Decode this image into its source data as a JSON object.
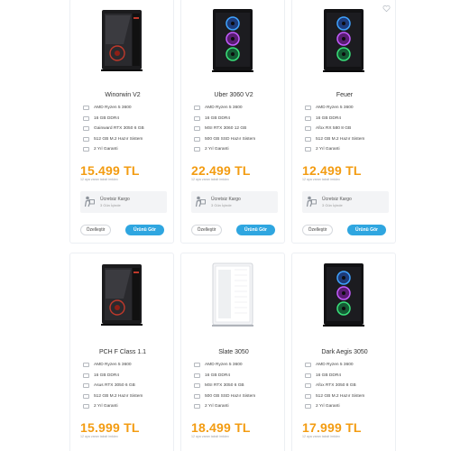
{
  "products": [
    {
      "name": "Winorwin V2",
      "case_style": "dark-red",
      "specs": [
        "AMD Ryzen 5 3600",
        "16 GB DDR4",
        "Gainward RTX 3050 6 GB",
        "512 GB M.2 Hazır Sistem",
        "2 Yıl Garanti"
      ],
      "price": "15.499 TL",
      "installment": "12 aya varan taksit imkânı",
      "shipping_title": "Ücretsiz Kargo",
      "shipping_sub": "3 Gün İçinde",
      "customize_label": "Özelleştir",
      "view_label": "Ürünü Gör"
    },
    {
      "name": "Uber 3060 V2",
      "case_style": "rgb",
      "specs": [
        "AMD Ryzen 5 3600",
        "16 GB DDR4",
        "MSI RTX 3060 12 GB",
        "500 GB SSD Hazır Sistem",
        "2 Yıl Garanti"
      ],
      "price": "22.499 TL",
      "installment": "12 aya varan taksit imkânı",
      "shipping_title": "Ücretsiz Kargo",
      "shipping_sub": "3 Gün İçinde",
      "customize_label": "Özelleştir",
      "view_label": "Ürünü Gör"
    },
    {
      "name": "Feuer",
      "case_style": "rgb",
      "favorite": true,
      "specs": [
        "AMD Ryzen 5 3600",
        "16 GB DDR4",
        "Afox RX 580 8 GB",
        "512 GB M.2 Hazır Sistem",
        "2 Yıl Garanti"
      ],
      "price": "12.499 TL",
      "installment": "12 aya varan taksit imkânı",
      "shipping_title": "Ücretsiz Kargo",
      "shipping_sub": "3 Gün İçinde",
      "customize_label": "Özelleştir",
      "view_label": "Ürünü Gör"
    },
    {
      "name": "PCH F Class 1.1",
      "case_style": "dark-red",
      "specs": [
        "AMD Ryzen 5 3600",
        "16 GB DDR4",
        "Asus RTX 3050 6 GB",
        "512 GB M.2 Hazır Sistem",
        "2 Yıl Garanti"
      ],
      "price": "15.999 TL",
      "installment": "12 aya varan taksit imkânı"
    },
    {
      "name": "Slate 3050",
      "case_style": "white",
      "specs": [
        "AMD Ryzen 5 3600",
        "16 GB DDR4",
        "MSI RTX 3050 6 GB",
        "500 GB SSD Hazır Sistem",
        "2 Yıl Garanti"
      ],
      "price": "18.499 TL",
      "installment": "12 aya varan taksit imkânı"
    },
    {
      "name": "Dark Aegis 3050",
      "case_style": "rgb",
      "specs": [
        "AMD Ryzen 5 3600",
        "16 GB DDR4",
        "Afox RTX 3050 8 GB",
        "512 GB M.2 Hazır Sistem",
        "2 Yıl Garanti"
      ],
      "price": "17.999 TL",
      "installment": "12 aya varan taksit imkânı"
    }
  ],
  "colors": {
    "price": "#f39c12",
    "primary_button": "#2fa6e0"
  }
}
